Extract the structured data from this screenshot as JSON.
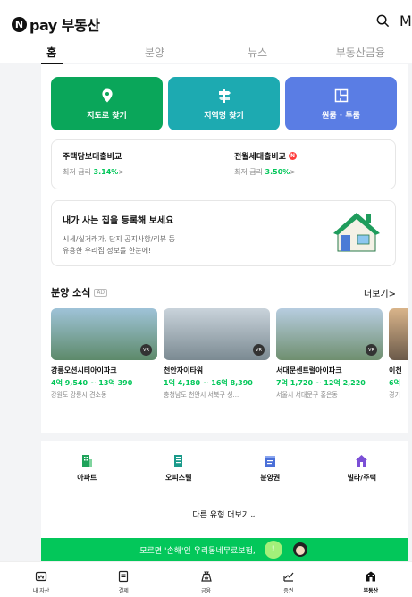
{
  "header": {
    "brand_mark": "N",
    "brand_text": "pay 부동산",
    "right_partial": "M",
    "tabs": [
      {
        "label": "홈",
        "active": true
      },
      {
        "label": "분양"
      },
      {
        "label": "뉴스"
      },
      {
        "label": "부동산금융"
      }
    ]
  },
  "quick_buttons": [
    {
      "label": "지도로 찾기",
      "color": "#0aa65a",
      "icon": "map-pin-icon"
    },
    {
      "label": "지역명 찾기",
      "color": "#1daab1",
      "icon": "signpost-icon"
    },
    {
      "label": "원룸 · 투룸",
      "color": "#5a7de4",
      "icon": "floorplan-icon"
    }
  ],
  "loans": [
    {
      "title": "주택담보대출비교",
      "rate_label": "최저 금리",
      "rate": "3.14%",
      "arrow": ">",
      "new": false
    },
    {
      "title": "전월세대출비교",
      "rate_label": "최저 금리",
      "rate": "3.50%",
      "arrow": ">",
      "new": true,
      "new_mark": "N"
    }
  ],
  "register": {
    "title": "내가 사는 집을 등록해 보세요",
    "desc_line1": "시세/실거래가, 단지 공지사항/리뷰 등",
    "desc_line2": "유용한 우리집 정보를 한눈에!"
  },
  "presale": {
    "title": "분양 소식",
    "ad": "AD",
    "more": "더보기>",
    "cards": [
      {
        "name": "강릉오션시티아이파크",
        "price": "4억 9,540 ~ 13억 390",
        "addr": "강원도 강릉시 견소동",
        "vr": "VR",
        "img_colors": [
          "#9fc3d8",
          "#5d8a6a"
        ]
      },
      {
        "name": "천안자이타워",
        "price": "1억 4,180 ~ 16억 8,390",
        "addr": "충청남도 천안시 서북구 성...",
        "vr": "VR",
        "img_colors": [
          "#c9d3db",
          "#7b8a92"
        ]
      },
      {
        "name": "서대문센트럴아이파크",
        "price": "7억 1,720 ~ 12억 2,220",
        "addr": "서울시 서대문구 홍은동",
        "vr": "VR",
        "img_colors": [
          "#b7cde0",
          "#6f8f6f"
        ]
      },
      {
        "name": "이천",
        "price": "6억",
        "addr": "경기",
        "vr": "",
        "img_colors": [
          "#d9b48a",
          "#6b5a4a"
        ]
      }
    ]
  },
  "types": [
    {
      "label": "아파트",
      "icon": "apartment-icon",
      "color": "#1ea35a"
    },
    {
      "label": "오피스텔",
      "icon": "officetel-icon",
      "color": "#1a9a8a"
    },
    {
      "label": "분양권",
      "icon": "presale-right-icon",
      "color": "#4a6fd8"
    },
    {
      "label": "빌라/주택",
      "icon": "villa-icon",
      "color": "#7b4fd6"
    }
  ],
  "types_more": "다른 유형 더보기",
  "banner": {
    "text": "모르면 '손해'인 우리동네무료보험,",
    "mark": "!"
  },
  "bottom_nav": [
    {
      "label": "내 자산",
      "icon": "wallet-icon"
    },
    {
      "label": "결제",
      "icon": "receipt-icon"
    },
    {
      "label": "금융",
      "icon": "money-bag-icon"
    },
    {
      "label": "증권",
      "icon": "stock-chart-icon"
    },
    {
      "label": "부동산",
      "icon": "building-icon",
      "active": true
    }
  ]
}
